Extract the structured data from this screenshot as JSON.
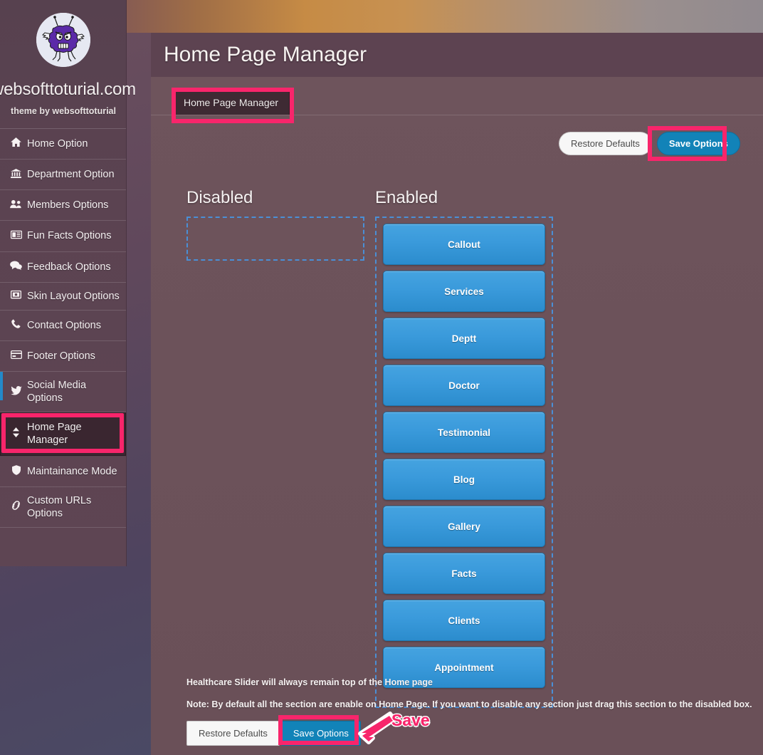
{
  "brand": {
    "site_title": "websofttoturial.com",
    "tagline": "theme by websofttoturial",
    "logo_icon": "monster-bug-logo-icon"
  },
  "sidebar": {
    "items": [
      {
        "label": "Home Option",
        "icon": "home-icon",
        "glyph": "⌂",
        "active": false
      },
      {
        "label": "Department Option",
        "icon": "bank-icon",
        "glyph": "ἽB",
        "active": false
      },
      {
        "label": "Members Options",
        "icon": "users-icon",
        "glyph": "὆5",
        "active": false
      },
      {
        "label": "Fun Facts Options",
        "icon": "newspaper-icon",
        "glyph": "὏0",
        "active": false
      },
      {
        "label": "Feedback Options",
        "icon": "comments-icon",
        "glyph": "὞9",
        "active": false
      },
      {
        "label": "Skin Layout Options",
        "icon": "image-icon",
        "glyph": "ὛC",
        "active": false
      },
      {
        "label": "Contact Options",
        "icon": "phone-icon",
        "glyph": "☎",
        "active": false
      },
      {
        "label": "Footer Options",
        "icon": "credit-card-icon",
        "glyph": "Ὃ3",
        "active": false
      },
      {
        "label": "Social Media Options",
        "icon": "twitter-icon",
        "glyph": "ὂ6",
        "active": false
      },
      {
        "label": "Home Page Manager",
        "icon": "sort-arrows-icon",
        "glyph": "↕",
        "active": true
      },
      {
        "label": "Maintainance Mode",
        "icon": "shield-icon",
        "glyph": "Ὦ1",
        "active": false
      },
      {
        "label": "Custom URLs Options",
        "icon": "link-icon",
        "glyph": "ὑ7",
        "active": false
      }
    ]
  },
  "header": {
    "title": "Home Page Manager"
  },
  "tabs": [
    {
      "label": "Home Page Manager",
      "active": true
    }
  ],
  "toolbar_top": {
    "restore_label": "Restore Defaults",
    "save_label": "Save Options"
  },
  "columns": {
    "disabled_title": "Disabled",
    "enabled_title": "Enabled",
    "disabled_items": [],
    "enabled_items": [
      "Callout",
      "Services",
      "Deptt",
      "Doctor",
      "Testimonial",
      "Blog",
      "Gallery",
      "Facts",
      "Clients",
      "Appointment"
    ]
  },
  "notes": {
    "line1": "Healthcare Slider will always remain top of the Home page",
    "note_label": "Note:",
    "note_text": " By default all the section are enable on Home Page. If you want to disable any section just drag this section to the disabled box."
  },
  "toolbar_bottom": {
    "restore_label": "Restore Defaults",
    "save_label": "Save Options"
  },
  "annotations": {
    "save_callout": "Save",
    "highlight_color": "#f8256b",
    "callout_color": "#f8256b"
  },
  "colors": {
    "accent_blue": "#2b8ccd",
    "save_blue": "#1283b8",
    "panel_bg": "#6c525a",
    "header_bg": "#5d4351",
    "sidebar_bg": "#5d4452",
    "dashed_border": "#4a8fd6"
  }
}
